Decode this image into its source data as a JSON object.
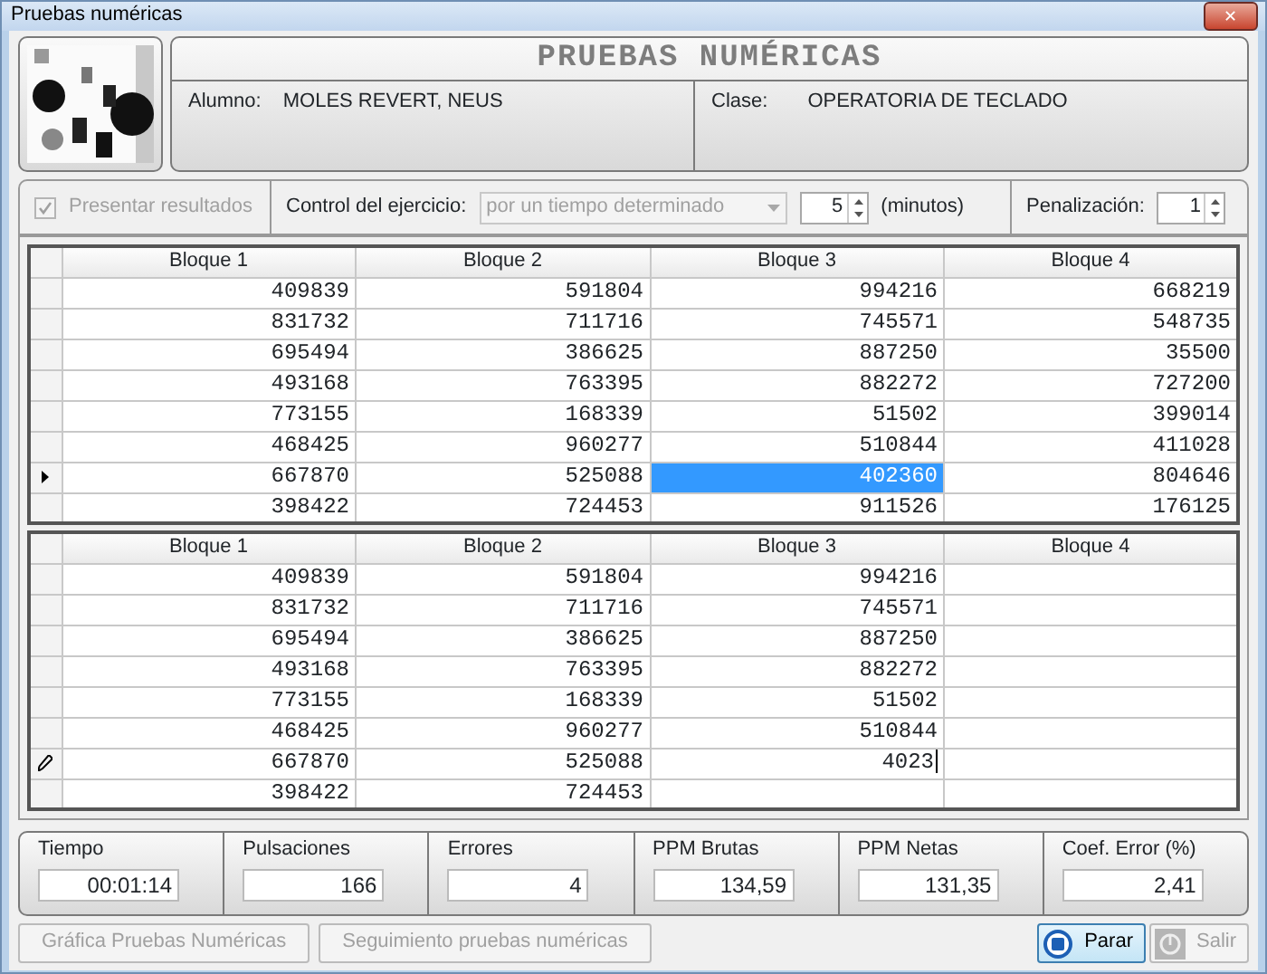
{
  "window": {
    "title": "Pruebas numéricas",
    "close": "✕"
  },
  "header": {
    "title": "PRUEBAS NUMÉRICAS",
    "student_label": "Alumno:",
    "student": "MOLES REVERT, NEUS",
    "class_label": "Clase:",
    "class": "OPERATORIA DE TECLADO"
  },
  "options": {
    "show_results": {
      "label": "Presentar resultados",
      "checked": true,
      "disabled": true
    },
    "control_label": "Control del ejercicio:",
    "control_value": "por un tiempo determinado",
    "control_disabled": true,
    "minutes": "5",
    "minutes_label": "(minutos)",
    "penalty_label": "Penalización:",
    "penalty": "1"
  },
  "grid_top": {
    "columns": [
      "Bloque 1",
      "Bloque 2",
      "Bloque 3",
      "Bloque 4"
    ],
    "rows": [
      {
        "current": false,
        "cells": [
          {
            "text": "409839",
            "selected": false
          },
          {
            "text": "591804",
            "selected": false
          },
          {
            "text": "994216",
            "selected": false
          },
          {
            "text": "668219",
            "selected": false
          }
        ]
      },
      {
        "current": false,
        "cells": [
          {
            "text": "831732",
            "selected": false
          },
          {
            "text": "711716",
            "selected": false
          },
          {
            "text": "745571",
            "selected": false
          },
          {
            "text": "548735",
            "selected": false
          }
        ]
      },
      {
        "current": false,
        "cells": [
          {
            "text": "695494",
            "selected": false
          },
          {
            "text": "386625",
            "selected": false
          },
          {
            "text": "887250",
            "selected": false
          },
          {
            "text": "35500",
            "selected": false
          }
        ]
      },
      {
        "current": false,
        "cells": [
          {
            "text": "493168",
            "selected": false
          },
          {
            "text": "763395",
            "selected": false
          },
          {
            "text": "882272",
            "selected": false
          },
          {
            "text": "727200",
            "selected": false
          }
        ]
      },
      {
        "current": false,
        "cells": [
          {
            "text": "773155",
            "selected": false
          },
          {
            "text": "168339",
            "selected": false
          },
          {
            "text": "51502",
            "selected": false
          },
          {
            "text": "399014",
            "selected": false
          }
        ]
      },
      {
        "current": false,
        "cells": [
          {
            "text": "468425",
            "selected": false
          },
          {
            "text": "960277",
            "selected": false
          },
          {
            "text": "510844",
            "selected": false
          },
          {
            "text": "411028",
            "selected": false
          }
        ]
      },
      {
        "current": true,
        "cells": [
          {
            "text": "667870",
            "selected": false
          },
          {
            "text": "525088",
            "selected": false
          },
          {
            "text": "402360",
            "selected": true
          },
          {
            "text": "804646",
            "selected": false
          }
        ]
      },
      {
        "current": false,
        "cells": [
          {
            "text": "398422",
            "selected": false
          },
          {
            "text": "724453",
            "selected": false
          },
          {
            "text": "911526",
            "selected": false
          },
          {
            "text": "176125",
            "selected": false
          }
        ]
      }
    ]
  },
  "grid_bottom": {
    "columns": [
      "Bloque 1",
      "Bloque 2",
      "Bloque 3",
      "Bloque 4"
    ],
    "rows": [
      {
        "editing": false,
        "cells": [
          "409839",
          "591804",
          "994216"
        ]
      },
      {
        "editing": false,
        "cells": [
          "831732",
          "711716",
          "745571"
        ]
      },
      {
        "editing": false,
        "cells": [
          "695494",
          "386625",
          "887250"
        ]
      },
      {
        "editing": false,
        "cells": [
          "493168",
          "763395",
          "882272"
        ]
      },
      {
        "editing": false,
        "cells": [
          "773155",
          "168339",
          "51502"
        ]
      },
      {
        "editing": false,
        "cells": [
          "468425",
          "960277",
          "510844"
        ]
      },
      {
        "editing": true,
        "cells": [
          "667870",
          "525088",
          "4023"
        ]
      },
      {
        "editing": false,
        "cells": [
          "398422",
          "724453"
        ]
      }
    ]
  },
  "stats": [
    {
      "label": "Tiempo",
      "value": "00:01:14"
    },
    {
      "label": "Pulsaciones",
      "value": "166"
    },
    {
      "label": "Errores",
      "value": "4"
    },
    {
      "label": "PPM Brutas",
      "value": "134,59"
    },
    {
      "label": "PPM Netas",
      "value": "131,35"
    },
    {
      "label": "Coef. Error (%)",
      "value": "2,41"
    }
  ],
  "buttons": [
    {
      "label": "Gráfica Pruebas Numéricas",
      "disabled": true
    },
    {
      "label": "Seguimiento pruebas numéricas",
      "disabled": true
    }
  ],
  "actions": [
    {
      "kind": "stop",
      "label": "Parar",
      "disabled": false
    },
    {
      "kind": "exit",
      "label": "Salir",
      "disabled": true
    }
  ]
}
